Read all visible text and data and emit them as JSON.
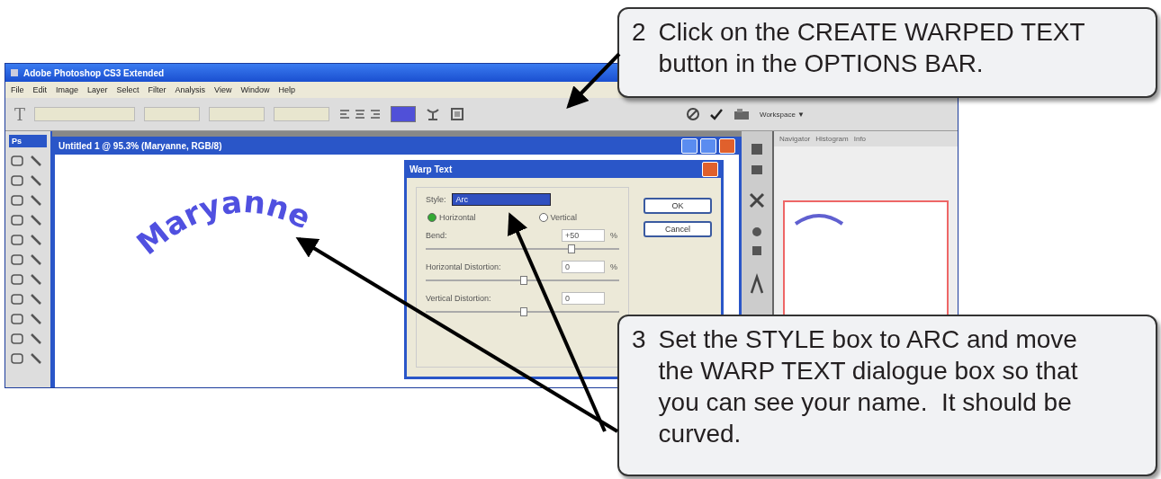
{
  "photoshop": {
    "title": "Adobe Photoshop CS3 Extended",
    "menu": [
      "File",
      "Edit",
      "Image",
      "Layer",
      "Select",
      "Filter",
      "Analysis",
      "View",
      "Window",
      "Help"
    ],
    "options_bar": {
      "tool_glyph": "T",
      "workspace": "Workspace ▼"
    },
    "toolbox": {
      "label": "Ps"
    },
    "document": {
      "title": "Untitled 1 @ 95.3% (Maryanne, RGB/8)",
      "canvas_text": "Maryanne"
    },
    "panel": {
      "tabs": [
        "Navigator",
        "Histogram",
        "Info"
      ]
    },
    "warp_dialog": {
      "title": "Warp Text",
      "style_label": "Style:",
      "style_value": "Arc",
      "orientations": [
        {
          "label": "Horizontal",
          "selected": true
        },
        {
          "label": "Vertical",
          "selected": false
        }
      ],
      "sliders": [
        {
          "label": "Bend:",
          "value": "+50",
          "unit": "%",
          "level": 0.75
        },
        {
          "label": "Horizontal Distortion:",
          "value": "0",
          "unit": "%",
          "level": 0.5
        },
        {
          "label": "Vertical Distortion:",
          "value": "0",
          "level": 0.5
        }
      ],
      "buttons": [
        "OK",
        "Cancel"
      ]
    }
  },
  "callouts": [
    {
      "number": "2",
      "text": "Click on the CREATE WARPED TEXT button in the OPTIONS BAR."
    },
    {
      "number": "3",
      "text": "Set the STYLE box to ARC and move the WARP TEXT dialogue box so that you can see your name.  It should be curved."
    }
  ]
}
